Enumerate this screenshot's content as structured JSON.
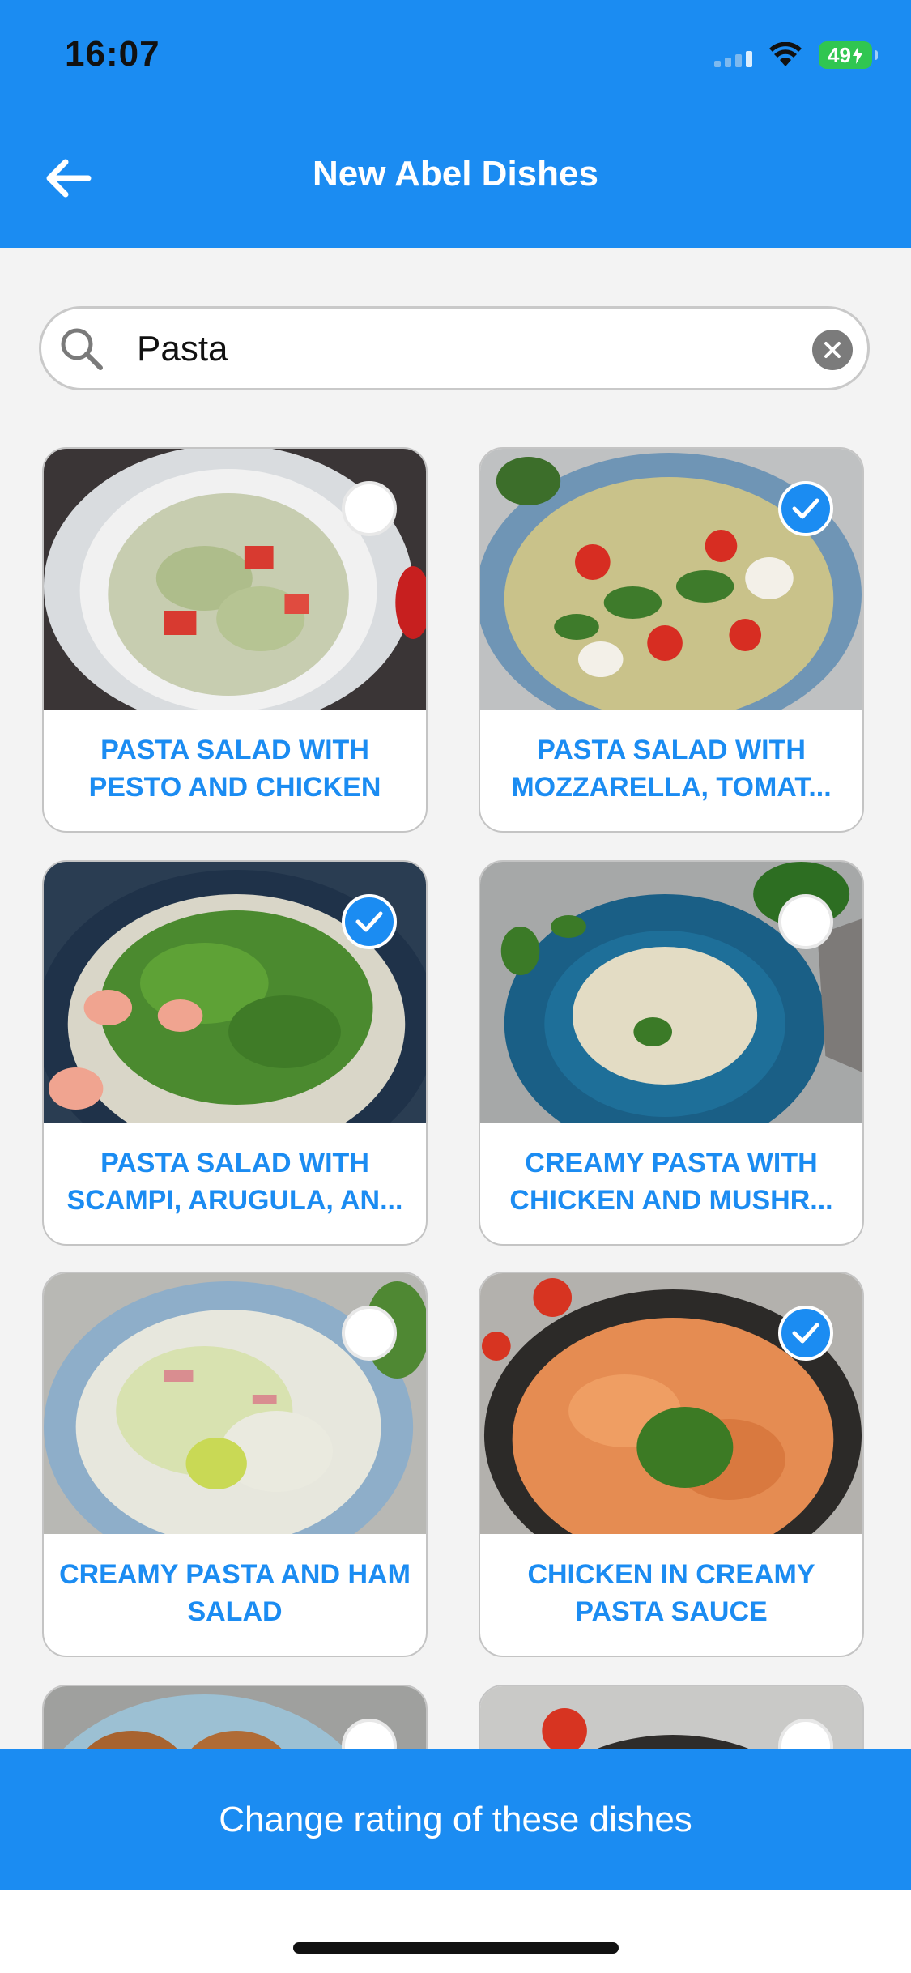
{
  "status_bar": {
    "time": "16:07",
    "battery": "49",
    "icons": [
      "signal-icon",
      "wifi-icon",
      "battery-icon"
    ]
  },
  "header": {
    "title": "New Abel Dishes",
    "back_icon": "arrow-left-icon"
  },
  "search": {
    "value": "Pasta",
    "icon": "search-icon",
    "clear_icon": "clear-icon"
  },
  "dishes": [
    {
      "title": "PASTA SALAD WITH PESTO AND CHICKEN",
      "selected": false,
      "photo": "bowl of pasta salad"
    },
    {
      "title": "PASTA SALAD WITH MOZZARELLA, TOMAT...",
      "selected": true,
      "photo": "bowl of pasta salad with tomatoes"
    },
    {
      "title": "PASTA SALAD WITH SCAMPI, ARUGULA, AN...",
      "selected": true,
      "photo": "plate of pasta with arugula and shrimp"
    },
    {
      "title": "CREAMY PASTA WITH CHICKEN AND MUSHR...",
      "selected": false,
      "photo": "blue plate of creamy pasta"
    },
    {
      "title": "CREAMY PASTA AND HAM SALAD",
      "selected": false,
      "photo": "plate of creamy pasta salad with lime"
    },
    {
      "title": "CHICKEN IN CREAMY PASTA SAUCE",
      "selected": true,
      "photo": "bowl of chicken in pasta sauce"
    },
    {
      "title": "",
      "selected": false,
      "photo": "partially visible dish"
    },
    {
      "title": "",
      "selected": false,
      "photo": "partially visible dish"
    }
  ],
  "footer": {
    "button_label": "Change rating of these dishes"
  },
  "colors": {
    "accent": "#1b8cf2",
    "background": "#f3f3f3",
    "battery": "#30c651"
  }
}
